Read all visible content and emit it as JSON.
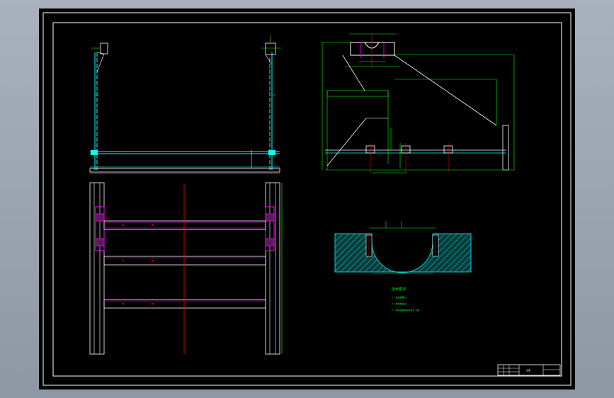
{
  "drawing": {
    "notes": {
      "heading": "技术要求",
      "items": [
        "1. 未注圆角R2。",
        "2. 去毛刺锐边。",
        "3. 焊接后需去除焊渣及飞溅。"
      ]
    },
    "title_block": {
      "name": "支架"
    }
  },
  "colors": {
    "background": "#000000",
    "frame": "#ffffff",
    "dimension": "#00ff00",
    "outline": "#00ffff",
    "centerline": "#ff0000",
    "hidden": "#ff00ff",
    "hatch": "#00cccc"
  }
}
